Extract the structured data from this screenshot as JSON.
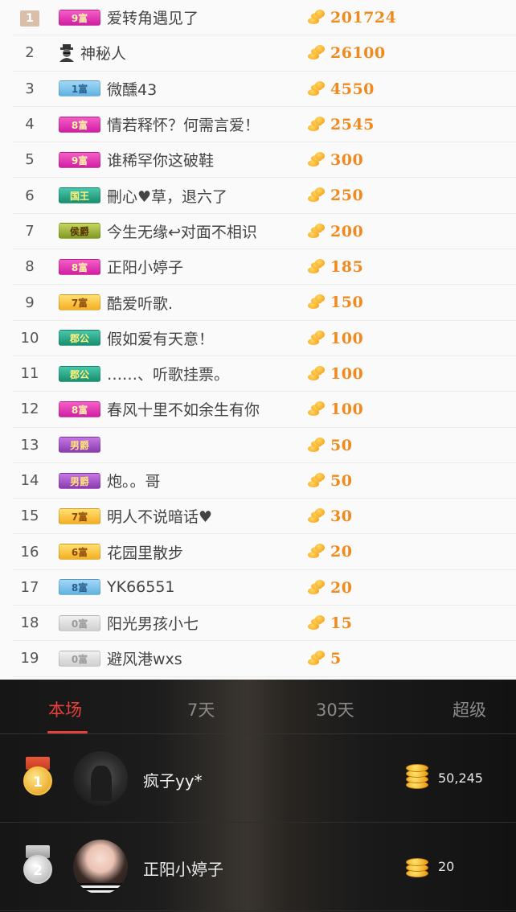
{
  "list": [
    {
      "rank": "1",
      "level": "9富",
      "level_style": "pink",
      "name": "爱转角遇见了",
      "score": "201724"
    },
    {
      "rank": "2",
      "level": "",
      "level_style": "mystery",
      "name": "神秘人",
      "score": "26100"
    },
    {
      "rank": "3",
      "level": "1富",
      "level_style": "blue",
      "name": "微醺43",
      "score": "4550"
    },
    {
      "rank": "4",
      "level": "8富",
      "level_style": "pink",
      "name": "情若释怀？何需言爱！",
      "score": "2545"
    },
    {
      "rank": "5",
      "level": "9富",
      "level_style": "pink",
      "name": "谁稀罕你这破鞋",
      "score": "300"
    },
    {
      "rank": "6",
      "level": "国王",
      "level_style": "teal",
      "name": "刪心♥草，退六了",
      "score": "250"
    },
    {
      "rank": "7",
      "level": "侯爵",
      "level_style": "olive",
      "name": "今生无缘↩对面不相识",
      "score": "200"
    },
    {
      "rank": "8",
      "level": "8富",
      "level_style": "pink",
      "name": "正阳小婷子",
      "score": "185"
    },
    {
      "rank": "9",
      "level": "7富",
      "level_style": "gold",
      "name": "酷爱听歌.",
      "score": "150"
    },
    {
      "rank": "10",
      "level": "郡公",
      "level_style": "teal",
      "name": "假如爱有天意！",
      "score": "100"
    },
    {
      "rank": "11",
      "level": "郡公",
      "level_style": "teal",
      "name": "……、听歌挂票。",
      "score": "100"
    },
    {
      "rank": "12",
      "level": "8富",
      "level_style": "pink",
      "name": "春风十里不如余生有你",
      "score": "100"
    },
    {
      "rank": "13",
      "level": "男爵",
      "level_style": "purple",
      "name": "",
      "score": "50"
    },
    {
      "rank": "14",
      "level": "男爵",
      "level_style": "purple",
      "name": "炮。。哥",
      "score": "50"
    },
    {
      "rank": "15",
      "level": "7富",
      "level_style": "gold",
      "name": "明人不说暗话♥",
      "score": "30"
    },
    {
      "rank": "16",
      "level": "6富",
      "level_style": "gold",
      "name": "花园里散步",
      "score": "20"
    },
    {
      "rank": "17",
      "level": "8富",
      "level_style": "blue",
      "name": "YK66551",
      "score": "20"
    },
    {
      "rank": "18",
      "level": "0富",
      "level_style": "gray",
      "name": "阳光男孩小七",
      "score": "15"
    },
    {
      "rank": "19",
      "level": "0富",
      "level_style": "gray",
      "name": "避风港wxs",
      "score": "5"
    }
  ],
  "tabs": [
    {
      "label": "本场",
      "active": true
    },
    {
      "label": "7天",
      "active": false
    },
    {
      "label": "30天",
      "active": false
    },
    {
      "label": "超级",
      "active": false
    }
  ],
  "podium": [
    {
      "medal": "1",
      "name": "疯子yy*",
      "value": "50,245"
    },
    {
      "medal": "2",
      "name": "正阳小婷子",
      "value": "20"
    }
  ],
  "colors": {
    "accent_red": "#e8413a",
    "score_orange": "#f08a1e"
  }
}
